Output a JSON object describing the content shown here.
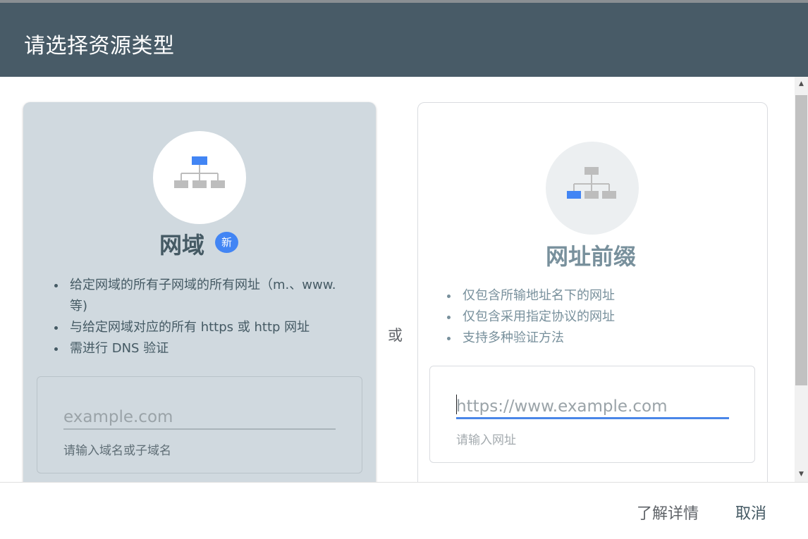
{
  "dialog": {
    "title": "请选择资源类型"
  },
  "domain_card": {
    "title": "网域",
    "badge": "新",
    "features": [
      "给定网域的所有子网域的所有网址（m.、www. 等)",
      "与给定网域对应的所有 https 或 http 网址",
      "需进行 DNS 验证"
    ],
    "input_placeholder": "example.com",
    "input_value": "",
    "hint": "请输入域名或子域名"
  },
  "separator": "或",
  "prefix_card": {
    "title": "网址前缀",
    "features": [
      "仅包含所输地址名下的网址",
      "仅包含采用指定协议的网址",
      "支持多种验证方法"
    ],
    "input_placeholder": "https://www.example.com",
    "input_value": "",
    "hint": "请输入网址"
  },
  "footer": {
    "learn_more_label": "了解详情",
    "cancel_label": "取消"
  },
  "colors": {
    "header_bg": "#485b67",
    "domain_card_bg": "#d0d9df",
    "accent_blue": "#4285f4",
    "icon_gray": "#bdbdbd"
  },
  "icons": {
    "domain_icon": "sitemap-icon-top-highlighted",
    "prefix_icon": "sitemap-icon-leaf-highlighted"
  }
}
